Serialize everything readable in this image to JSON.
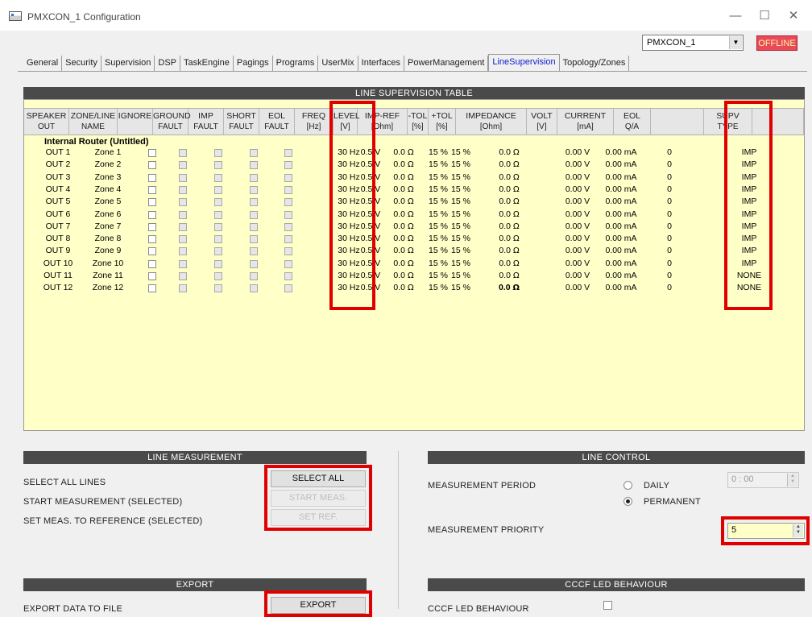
{
  "window": {
    "title": "PMXCON_1 Configuration",
    "minimize": "—",
    "maximize": "☐",
    "close": "✕"
  },
  "device": {
    "selected": "PMXCON_1",
    "status": "OFFLINE"
  },
  "tabs": [
    "General",
    "Security",
    "Supervision",
    "DSP",
    "TaskEngine",
    "Pagings",
    "Programs",
    "UserMix",
    "Interfaces",
    "PowerManagement",
    "LineSupervision",
    "Topology/Zones"
  ],
  "active_tab": "LineSupervision",
  "table": {
    "title": "LINE SUPERVISION TABLE",
    "headers": [
      {
        "l1": "SPEAKER",
        "l2": "OUT"
      },
      {
        "l1": "ZONE/LINE",
        "l2": "NAME"
      },
      {
        "l1": "IGNORE",
        "l2": ""
      },
      {
        "l1": "GROUND",
        "l2": "FAULT"
      },
      {
        "l1": "IMP",
        "l2": "FAULT"
      },
      {
        "l1": "SHORT",
        "l2": "FAULT"
      },
      {
        "l1": "EOL",
        "l2": "FAULT"
      },
      {
        "l1": "FREQ",
        "l2": "[Hz]"
      },
      {
        "l1": "LEVEL",
        "l2": "[V]"
      },
      {
        "l1": "IMP-REF",
        "l2": "[Ohm]"
      },
      {
        "l1": "-TOL",
        "l2": "[%]"
      },
      {
        "l1": "+TOL",
        "l2": "[%]"
      },
      {
        "l1": "IMPEDANCE",
        "l2": "[Ohm]"
      },
      {
        "l1": "VOLT",
        "l2": "[V]"
      },
      {
        "l1": "CURRENT",
        "l2": "[mA]"
      },
      {
        "l1": "EOL",
        "l2": "Q/A"
      },
      {
        "l1": "",
        "l2": ""
      },
      {
        "l1": "SUPV",
        "l2": "TYPE"
      }
    ],
    "group": "Internal Router (Untitled)",
    "rows": [
      {
        "out": "OUT 1",
        "zone": "Zone 1",
        "freq": "30 Hz",
        "level": "0.5 V",
        "impref": "0.0",
        "ntol": "15 %",
        "ptol": "15 %",
        "imp": "0.0",
        "volt": "0.00 V",
        "current": "0.00 mA",
        "eol": "0",
        "supv": "IMP"
      },
      {
        "out": "OUT 2",
        "zone": "Zone 2",
        "freq": "30 Hz",
        "level": "0.5 V",
        "impref": "0.0",
        "ntol": "15 %",
        "ptol": "15 %",
        "imp": "0.0",
        "volt": "0.00 V",
        "current": "0.00 mA",
        "eol": "0",
        "supv": "IMP"
      },
      {
        "out": "OUT 3",
        "zone": "Zone 3",
        "freq": "30 Hz",
        "level": "0.5 V",
        "impref": "0.0",
        "ntol": "15 %",
        "ptol": "15 %",
        "imp": "0.0",
        "volt": "0.00 V",
        "current": "0.00 mA",
        "eol": "0",
        "supv": "IMP"
      },
      {
        "out": "OUT 4",
        "zone": "Zone 4",
        "freq": "30 Hz",
        "level": "0.5 V",
        "impref": "0.0",
        "ntol": "15 %",
        "ptol": "15 %",
        "imp": "0.0",
        "volt": "0.00 V",
        "current": "0.00 mA",
        "eol": "0",
        "supv": "IMP"
      },
      {
        "out": "OUT 5",
        "zone": "Zone 5",
        "freq": "30 Hz",
        "level": "0.5 V",
        "impref": "0.0",
        "ntol": "15 %",
        "ptol": "15 %",
        "imp": "0.0",
        "volt": "0.00 V",
        "current": "0.00 mA",
        "eol": "0",
        "supv": "IMP"
      },
      {
        "out": "OUT 6",
        "zone": "Zone 6",
        "freq": "30 Hz",
        "level": "0.5 V",
        "impref": "0.0",
        "ntol": "15 %",
        "ptol": "15 %",
        "imp": "0.0",
        "volt": "0.00 V",
        "current": "0.00 mA",
        "eol": "0",
        "supv": "IMP"
      },
      {
        "out": "OUT 7",
        "zone": "Zone 7",
        "freq": "30 Hz",
        "level": "0.5 V",
        "impref": "0.0",
        "ntol": "15 %",
        "ptol": "15 %",
        "imp": "0.0",
        "volt": "0.00 V",
        "current": "0.00 mA",
        "eol": "0",
        "supv": "IMP"
      },
      {
        "out": "OUT 8",
        "zone": "Zone 8",
        "freq": "30 Hz",
        "level": "0.5 V",
        "impref": "0.0",
        "ntol": "15 %",
        "ptol": "15 %",
        "imp": "0.0",
        "volt": "0.00 V",
        "current": "0.00 mA",
        "eol": "0",
        "supv": "IMP"
      },
      {
        "out": "OUT 9",
        "zone": "Zone 9",
        "freq": "30 Hz",
        "level": "0.5 V",
        "impref": "0.0",
        "ntol": "15 %",
        "ptol": "15 %",
        "imp": "0.0",
        "volt": "0.00 V",
        "current": "0.00 mA",
        "eol": "0",
        "supv": "IMP"
      },
      {
        "out": "OUT 10",
        "zone": "Zone 10",
        "freq": "30 Hz",
        "level": "0.5 V",
        "impref": "0.0",
        "ntol": "15 %",
        "ptol": "15 %",
        "imp": "0.0",
        "volt": "0.00 V",
        "current": "0.00 mA",
        "eol": "0",
        "supv": "IMP"
      },
      {
        "out": "OUT 11",
        "zone": "Zone 11",
        "freq": "30 Hz",
        "level": "0.5 V",
        "impref": "0.0",
        "ntol": "15 %",
        "ptol": "15 %",
        "imp": "0.0",
        "volt": "0.00 V",
        "current": "0.00 mA",
        "eol": "0",
        "supv": "NONE"
      },
      {
        "out": "OUT 12",
        "zone": "Zone 12",
        "freq": "30 Hz",
        "level": "0.5 V",
        "impref": "0.0",
        "ntol": "15 %",
        "ptol": "15 %",
        "imp": "0.0",
        "volt": "0.00 V",
        "current": "0.00 mA",
        "eol": "0",
        "supv": "NONE",
        "bold_imp": true
      }
    ],
    "omega": "Ω"
  },
  "line_measurement": {
    "title": "LINE MEASUREMENT",
    "select_all_label": "SELECT ALL LINES",
    "start_label": "START MEASUREMENT (SELECTED)",
    "setref_label": "SET MEAS. TO REFERENCE (SELECTED)",
    "select_all_button": "SELECT ALL",
    "start_button": "START MEAS.",
    "setref_button": "SET REF."
  },
  "export": {
    "title": "EXPORT",
    "label": "EXPORT DATA TO FILE",
    "button": "EXPORT"
  },
  "line_control": {
    "title": "LINE CONTROL",
    "period_label": "MEASUREMENT PERIOD",
    "daily": "DAILY",
    "permanent": "PERMANENT",
    "time_value": "0 : 00",
    "priority_label": "MEASUREMENT PRIORITY",
    "priority_value": "5"
  },
  "cccf": {
    "title": "CCCF LED BEHAVIOUR",
    "label": "CCCF LED BEHAVIOUR"
  },
  "colors": {
    "table_bg": "#ffffc8",
    "section_bar": "#4a4a4a",
    "highlight": "#e00000",
    "offline": "#e84a5a",
    "active_tab": "#1020d0"
  }
}
